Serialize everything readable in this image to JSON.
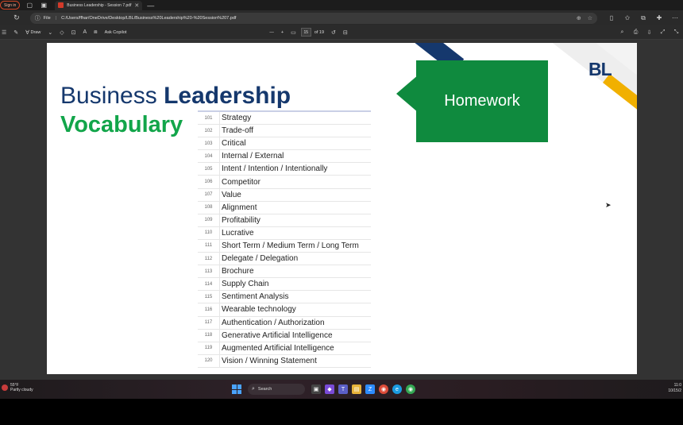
{
  "titlebar": {
    "sign_in": "Sign in",
    "tab_title": "Business Leadership - Session 7.pdf",
    "tab_close": "✕",
    "new_tab": "—"
  },
  "address": {
    "scheme": "File",
    "separator": "|",
    "url": "C:/Users/ffhar/OneDrive/Desktop/LBL/Business%20Leadership%20-%20Session%207.pdf"
  },
  "pdf_toolbar": {
    "draw_label": "Draw",
    "ask_copilot": "Ask Copilot",
    "zoom_out": "—",
    "zoom_in": "+",
    "page_number": "15",
    "page_total": "of 19"
  },
  "slide": {
    "title_regular": "Business",
    "title_bold": "Leadership",
    "subtitle": "Vocabulary",
    "homework": "Homework",
    "logo": "BL",
    "vocab": [
      {
        "num": "101",
        "term": "Strategy"
      },
      {
        "num": "102",
        "term": "Trade-off"
      },
      {
        "num": "103",
        "term": "Critical"
      },
      {
        "num": "104",
        "term": "Internal / External"
      },
      {
        "num": "105",
        "term": "Intent / Intention / Intentionally"
      },
      {
        "num": "106",
        "term": "Competitor"
      },
      {
        "num": "107",
        "term": "Value"
      },
      {
        "num": "108",
        "term": "Alignment"
      },
      {
        "num": "109",
        "term": "Profitability"
      },
      {
        "num": "110",
        "term": "Lucrative"
      },
      {
        "num": "111",
        "term": "Short Term / Medium Term / Long Term"
      },
      {
        "num": "112",
        "term": "Delegate / Delegation"
      },
      {
        "num": "113",
        "term": "Brochure"
      },
      {
        "num": "114",
        "term": "Supply Chain"
      },
      {
        "num": "115",
        "term": "Sentiment Analysis"
      },
      {
        "num": "116",
        "term": "Wearable technology"
      },
      {
        "num": "117",
        "term": "Authentication / Authorization"
      },
      {
        "num": "118",
        "term": "Generative Artificial Intelligence"
      },
      {
        "num": "119",
        "term": "Augmented Artificial Intelligence"
      },
      {
        "num": "120",
        "term": "Vision / Winning Statement"
      }
    ],
    "colors": {
      "navy": "#15386d",
      "green": "#12a54a",
      "homework_bg": "#0f8a3e",
      "gold": "#f1b000"
    }
  },
  "taskbar": {
    "weather_temp": "55°F",
    "weather_desc": "Partly cloudy",
    "search_label": "Search",
    "clock_time": "11:0",
    "clock_date": "10/15/2"
  }
}
